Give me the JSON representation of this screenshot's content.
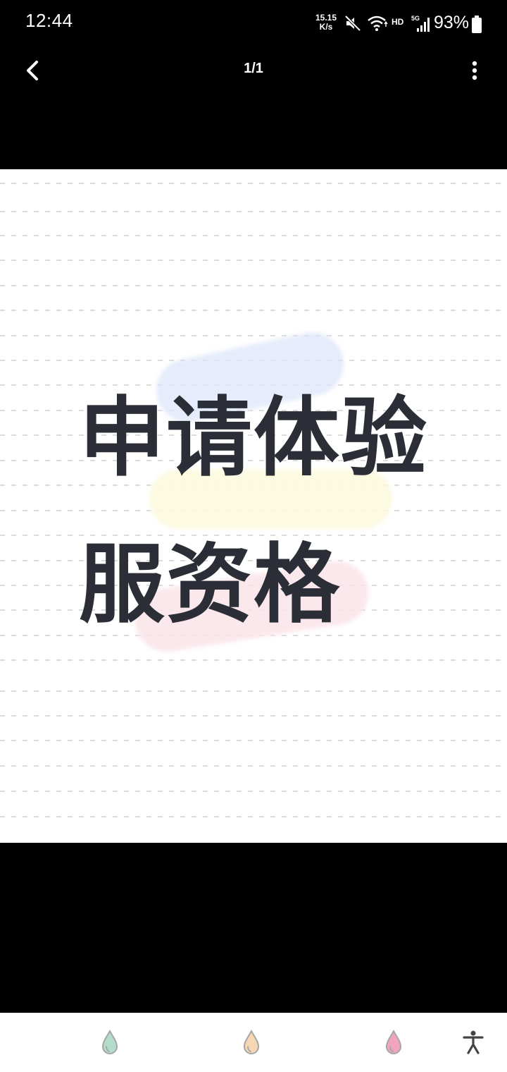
{
  "status_bar": {
    "time": "12:44",
    "net_speed_value": "15.15",
    "net_speed_unit": "K/s",
    "hd": "HD",
    "network": "5G",
    "battery": "93%"
  },
  "top_bar": {
    "page_counter": "1/1"
  },
  "image": {
    "line1": "申请体验",
    "line2": "服资格"
  },
  "bottom_nav": {
    "icons": [
      "drop-teal-icon",
      "drop-peach-icon",
      "drop-pink-icon",
      "accessibility-icon"
    ]
  },
  "colors": {
    "text": "#2b2e36",
    "drop_teal": "#b4dccb",
    "drop_peach": "#f6d7b4",
    "drop_pink": "#f1a5bd"
  }
}
